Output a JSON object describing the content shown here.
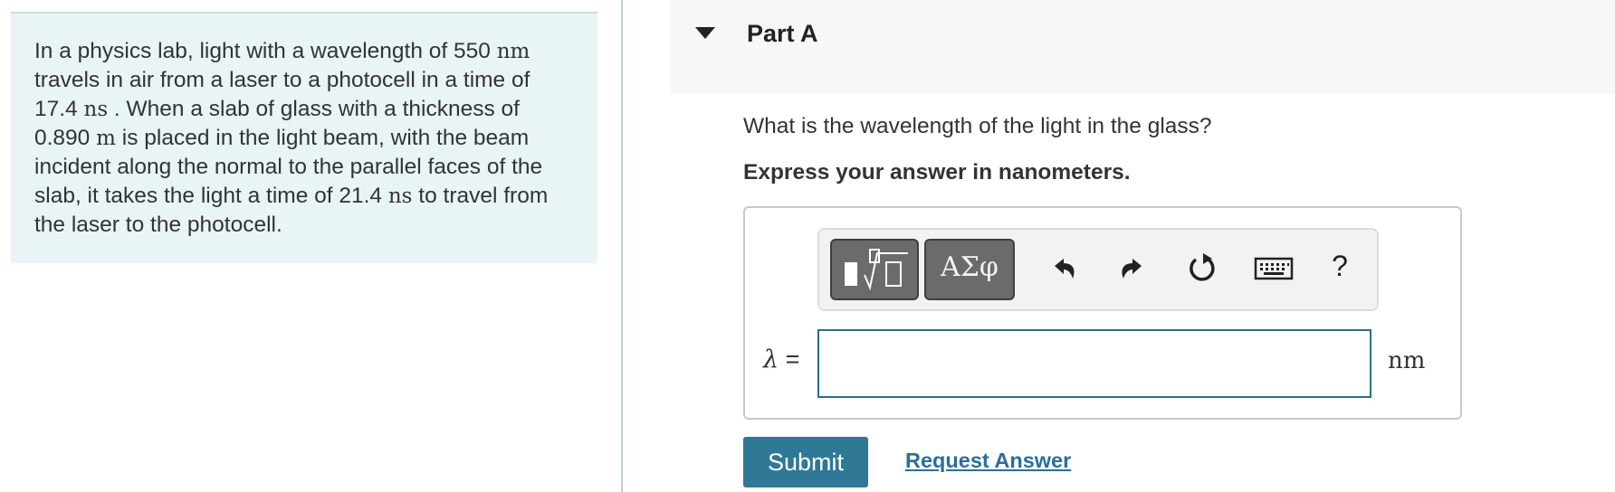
{
  "problem": {
    "seg1": "In a physics lab, light with a wavelength of 550 ",
    "unit1": "nm",
    "seg2": " travels in air from a laser to a photocell in a time of 17.4 ",
    "unit2": "ns",
    "seg3": " . When a slab of glass with a thickness of 0.890 ",
    "unit3": "m",
    "seg4": " is placed in the light beam, with the beam incident along the normal to the parallel faces of the slab, it takes the light a time of 21.4 ",
    "unit4": "ns",
    "seg5": " to travel from the laser to the photocell."
  },
  "part": {
    "title": "Part A",
    "question": "What is the wavelength of the light in the glass?",
    "instruction": "Express your answer in nanometers."
  },
  "toolbar": {
    "templates_icon": "sqrt-template-icon",
    "symbols_label": "ΑΣφ",
    "undo_icon": "undo-icon",
    "redo_icon": "redo-icon",
    "reset_icon": "reset-icon",
    "keyboard_icon": "keyboard-icon",
    "help_label": "?"
  },
  "answer": {
    "variable": "λ",
    "equals": "=",
    "value": "",
    "unit": "nm"
  },
  "actions": {
    "submit_label": "Submit",
    "request_answer_label": "Request Answer"
  },
  "colors": {
    "panel_bg": "#e8f4f5",
    "accent": "#2f7896",
    "link": "#2a6f9c"
  }
}
